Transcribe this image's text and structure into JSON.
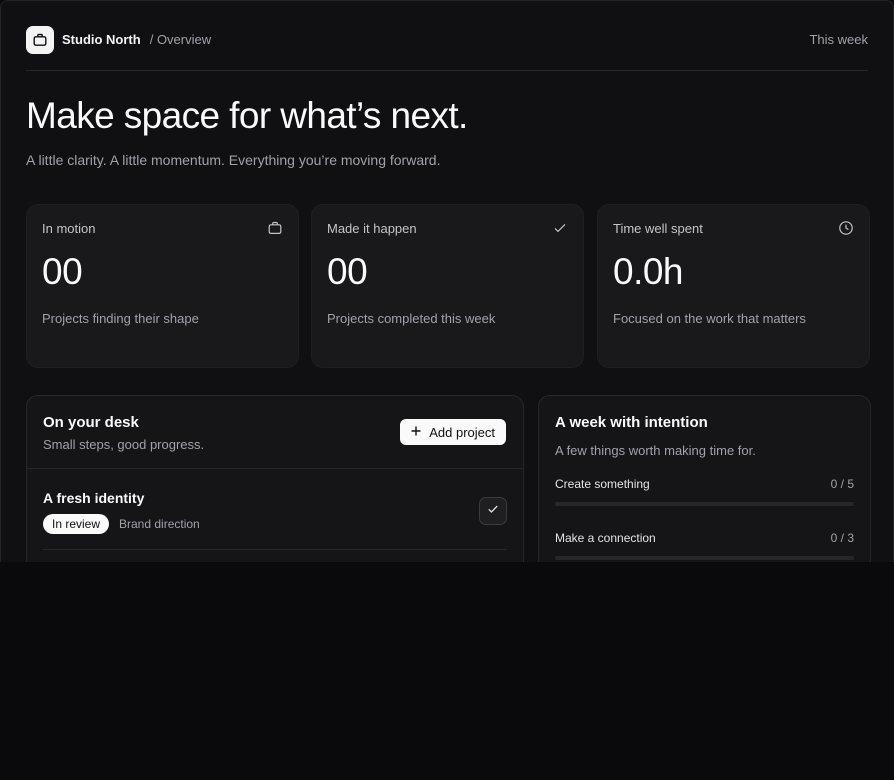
{
  "header": {
    "brand": "Studio North",
    "breadcrumb": "/ Overview",
    "range": "This week"
  },
  "hero": {
    "title": "Make space for what’s next.",
    "subtitle": "A little clarity. A little momentum. Everything you’re moving forward."
  },
  "stats": [
    {
      "label": "In motion",
      "value": "00",
      "caption": "Projects finding their shape",
      "icon": "briefcase-icon"
    },
    {
      "label": "Made it happen",
      "value": "00",
      "caption": "Projects completed this week",
      "icon": "check-icon"
    },
    {
      "label": "Time well spent",
      "value": "0.0h",
      "caption": "Focused on the work that matters",
      "icon": "clock-icon"
    }
  ],
  "desk": {
    "title": "On your desk",
    "subtitle": "Small steps, good progress.",
    "add_label": "Add project",
    "items": [
      {
        "title": "A fresh identity",
        "status": "In review",
        "category": "Brand direction"
      }
    ]
  },
  "week": {
    "title": "A week with intention",
    "subtitle": "A few things worth making time for.",
    "goals": [
      {
        "label": "Create something",
        "count": "0 / 5",
        "progress": 0
      },
      {
        "label": "Make a connection",
        "count": "0 / 3",
        "progress": 0
      }
    ]
  },
  "colors": {
    "background": "#0a0a0c",
    "card": "#19191c",
    "accent": "#fafafa",
    "muted_text": "#a1a1aa"
  }
}
